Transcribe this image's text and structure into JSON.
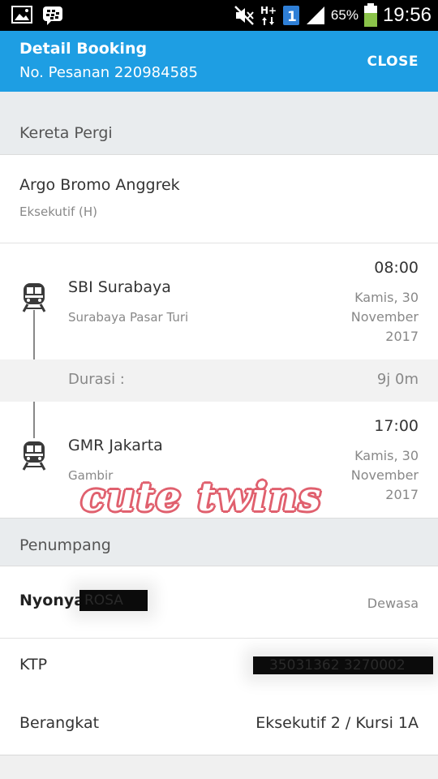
{
  "status_bar": {
    "battery_percent": "65%",
    "time": "19:56",
    "icons": [
      "gallery-icon",
      "bbm-icon",
      "mute-icon",
      "hplus-data-icon",
      "sim-1-icon",
      "signal-icon",
      "battery-icon"
    ]
  },
  "header": {
    "title": "Detail Booking",
    "order_number": "No. Pesanan 220984585",
    "close_label": "CLOSE",
    "color": "#1e9ee3"
  },
  "trip": {
    "section_title": "Kereta Pergi",
    "train_name": "Argo Bromo Anggrek",
    "train_class": "Eksekutif (H)",
    "departure": {
      "station": "SBI Surabaya",
      "station_full": "Surabaya Pasar Turi",
      "time": "08:00",
      "date_line1": "Kamis, 30",
      "date_line2": "November",
      "date_line3": "2017"
    },
    "duration_label": "Durasi :",
    "duration_value": "9j 0m",
    "arrival": {
      "station": "GMR Jakarta",
      "station_full": "Gambir",
      "time": "17:00",
      "date_line1": "Kamis, 30",
      "date_line2": "November",
      "date_line3": "2017"
    }
  },
  "passenger": {
    "section_title": "Penumpang",
    "title": "Nyonya",
    "name_redacted": "ROSA",
    "type": "Dewasa",
    "id_label": "KTP",
    "id_value_redacted": "35031362 3270002",
    "seat_label": "Berangkat",
    "seat_value": "Eksekutif 2 / Kursi 1A"
  },
  "watermark": "cute twins"
}
